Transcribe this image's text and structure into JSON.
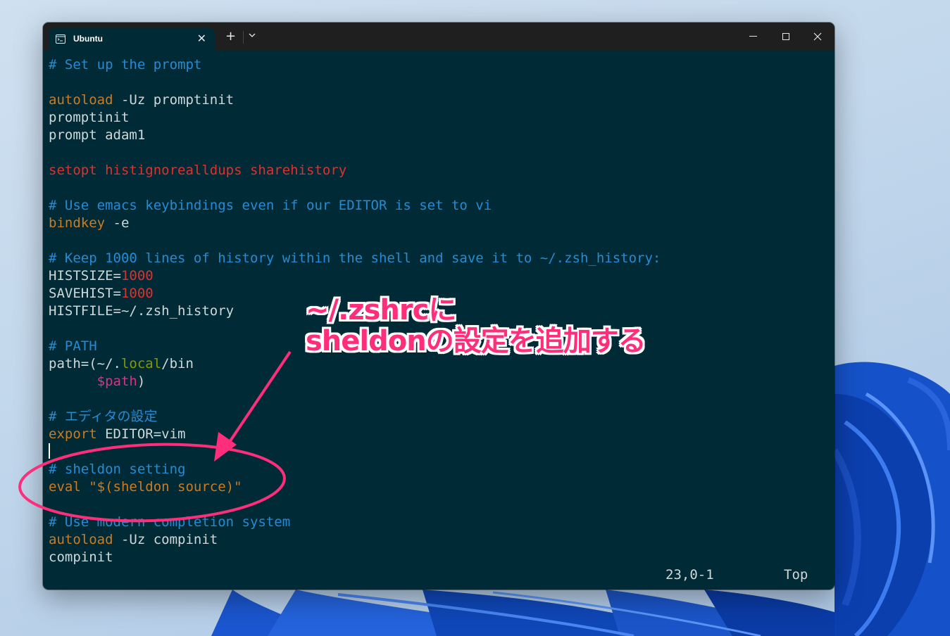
{
  "window": {
    "tab_title": "Ubuntu",
    "tab_close": "✕",
    "new_tab": "+",
    "minimize": "—",
    "maximize": "☐",
    "close": "✕"
  },
  "terminal": {
    "lines": [
      [
        {
          "t": "# Set up the prompt",
          "c": "comment"
        }
      ],
      [],
      [
        {
          "t": "autoload",
          "c": "kw"
        },
        {
          "t": " -Uz promptinit",
          "c": "plain"
        }
      ],
      [
        {
          "t": "promptinit",
          "c": "plain"
        }
      ],
      [
        {
          "t": "prompt adam1",
          "c": "plain"
        }
      ],
      [],
      [
        {
          "t": "setopt histignorealldups sharehistory",
          "c": "red"
        }
      ],
      [],
      [
        {
          "t": "# Use emacs keybindings even if our EDITOR is set to vi",
          "c": "comment"
        }
      ],
      [
        {
          "t": "bindkey",
          "c": "kw"
        },
        {
          "t": " -e",
          "c": "plain"
        }
      ],
      [],
      [
        {
          "t": "# Keep 1000 lines of history within the shell and save it to ~/.zsh_history:",
          "c": "comment"
        }
      ],
      [
        {
          "t": "HISTSIZE=",
          "c": "plain"
        },
        {
          "t": "1000",
          "c": "red"
        }
      ],
      [
        {
          "t": "SAVEHIST=",
          "c": "plain"
        },
        {
          "t": "1000",
          "c": "red"
        }
      ],
      [
        {
          "t": "HISTFILE=~/.zsh_history",
          "c": "plain"
        }
      ],
      [],
      [
        {
          "t": "# PATH",
          "c": "comment"
        }
      ],
      [
        {
          "t": "path=(~/.",
          "c": "plain"
        },
        {
          "t": "local",
          "c": "green"
        },
        {
          "t": "/bin",
          "c": "plain"
        }
      ],
      [
        {
          "t": "      ",
          "c": "plain"
        },
        {
          "t": "$path",
          "c": "mag"
        },
        {
          "t": ")",
          "c": "plain"
        }
      ],
      [],
      [
        {
          "t": "# エディタの設定",
          "c": "comment"
        }
      ],
      [
        {
          "t": "export",
          "c": "kw"
        },
        {
          "t": " EDITOR=vim",
          "c": "plain"
        }
      ],
      [
        {
          "cursor": true
        }
      ],
      [
        {
          "t": "# sheldon setting",
          "c": "comment"
        }
      ],
      [
        {
          "t": "eval",
          "c": "kw"
        },
        {
          "t": " ",
          "c": "plain"
        },
        {
          "t": "\"$(sheldon source)\"",
          "c": "kw"
        }
      ],
      [],
      [
        {
          "t": "# Use modern completion system",
          "c": "comment"
        }
      ],
      [
        {
          "t": "autoload",
          "c": "kw"
        },
        {
          "t": " -Uz compinit",
          "c": "plain"
        }
      ],
      [
        {
          "t": "compinit",
          "c": "plain"
        }
      ]
    ]
  },
  "status": {
    "position": "23,0-1",
    "scroll": "Top"
  },
  "annotation": {
    "line1": "~/.zshrcに",
    "line2": "sheldonの設定を追加する",
    "color": "#ff2e7a"
  }
}
